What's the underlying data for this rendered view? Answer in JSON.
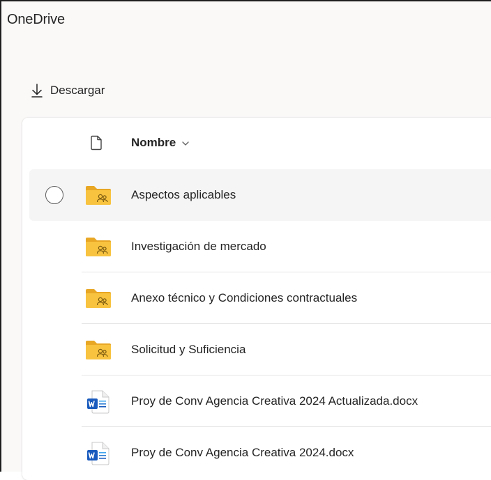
{
  "app": {
    "title": "OneDrive"
  },
  "toolbar": {
    "download_label": "Descargar"
  },
  "list": {
    "header_name": "Nombre",
    "items": [
      {
        "name": "Aspectos aplicables",
        "type": "shared-folder"
      },
      {
        "name": "Investigación de mercado",
        "type": "shared-folder"
      },
      {
        "name": "Anexo técnico y Condiciones contractuales",
        "type": "shared-folder"
      },
      {
        "name": "Solicitud y Suficiencia",
        "type": "shared-folder"
      },
      {
        "name": "Proy de Conv Agencia Creativa 2024 Actualizada.docx",
        "type": "word-document"
      },
      {
        "name": "Proy de Conv Agencia Creativa 2024.docx",
        "type": "word-document"
      }
    ]
  },
  "colors": {
    "folder": "#f8c33f",
    "folder_dark": "#e8a724",
    "word": "#185abd"
  }
}
